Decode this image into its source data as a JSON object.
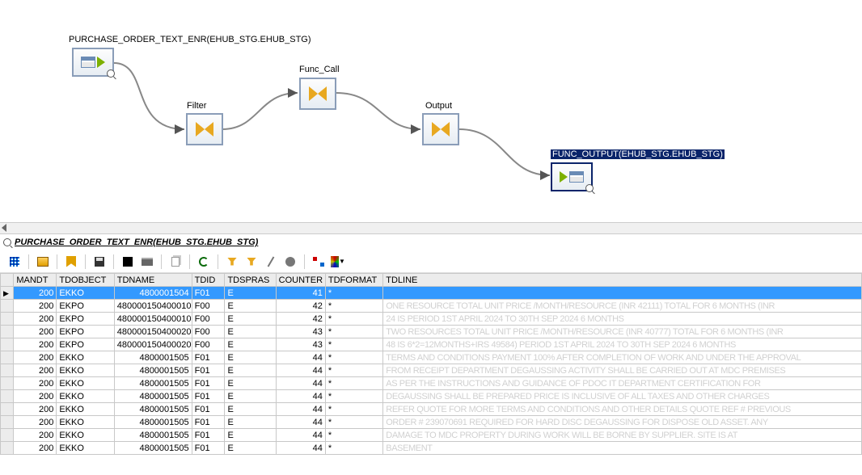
{
  "diagram": {
    "nodes": [
      {
        "id": 0,
        "label": "PURCHASE_ORDER_TEXT_ENR(EHUB_STG.EHUB_STG)",
        "type": "source"
      },
      {
        "id": 1,
        "label": "Filter",
        "type": "transform"
      },
      {
        "id": 2,
        "label": "Func_Call",
        "type": "transform"
      },
      {
        "id": 3,
        "label": "Output",
        "type": "transform"
      },
      {
        "id": 4,
        "label": "FUNC_OUTPUT(EHUB_STG.EHUB_STG)",
        "type": "target",
        "selected": true
      }
    ]
  },
  "tab_title": "PURCHASE_ORDER_TEXT_ENR(EHUB_STG.EHUB_STG)",
  "columns": [
    "MANDT",
    "TDOBJECT",
    "TDNAME",
    "TDID",
    "TDSPRAS",
    "COUNTER",
    "TDFORMAT",
    "TDLINE"
  ],
  "rows": [
    {
      "mandt": "200",
      "tdobject": "EKKO",
      "tdname": "4800001504",
      "tdid": "F01",
      "tdspras": "E",
      "counter": "41",
      "tdformat": "*",
      "tdline": "",
      "sel": true
    },
    {
      "mandt": "200",
      "tdobject": "EKPO",
      "tdname": "480000150400010",
      "tdid": "F00",
      "tdspras": "E",
      "counter": "42",
      "tdformat": "*",
      "tdline": "ONE RESOURCE TOTAL UNIT PRICE /MONTH/RESOURCE  (INR 42111) TOTAL FOR 6 MONTHS (INR"
    },
    {
      "mandt": "200",
      "tdobject": "EKPO",
      "tdname": "480000150400010",
      "tdid": "F00",
      "tdspras": "E",
      "counter": "42",
      "tdformat": "*",
      "tdline": "24 IS PERIOD  1ST APRIL 2024 TO 30TH SEP  2024 6 MONTHS"
    },
    {
      "mandt": "200",
      "tdobject": "EKPO",
      "tdname": "480000150400020",
      "tdid": "F00",
      "tdspras": "E",
      "counter": "43",
      "tdformat": "*",
      "tdline": "TWO RESOURCES TOTAL UNIT PRICE /MONTH/RESOURCE  (INR 40777) TOTAL FOR 6 MONTHS (INR"
    },
    {
      "mandt": "200",
      "tdobject": "EKPO",
      "tdname": "480000150400020",
      "tdid": "F00",
      "tdspras": "E",
      "counter": "43",
      "tdformat": "*",
      "tdline": "48 IS 6*2=12MONTHS+IRS  49584) PERIOD 1ST APRIL 2024 TO 30TH SEP 2024 6 MONTHS"
    },
    {
      "mandt": "200",
      "tdobject": "EKKO",
      "tdname": "4800001505",
      "tdid": "F01",
      "tdspras": "E",
      "counter": "44",
      "tdformat": "*",
      "tdline": "TERMS AND CONDITIONS  PAYMENT  100% AFTER COMPLETION OF WORK AND UNDER THE APPROVAL"
    },
    {
      "mandt": "200",
      "tdobject": "EKKO",
      "tdname": "4800001505",
      "tdid": "F01",
      "tdspras": "E",
      "counter": "44",
      "tdformat": "*",
      "tdline": "FROM RECEIPT DEPARTMENT  DEGAUSSING ACTIVITY SHALL BE CARRIED OUT AT  MDC PREMISES"
    },
    {
      "mandt": "200",
      "tdobject": "EKKO",
      "tdname": "4800001505",
      "tdid": "F01",
      "tdspras": "E",
      "counter": "44",
      "tdformat": "*",
      "tdline": "AS PER THE INSTRUCTIONS AND GUIDANCE OF PDOC IT DEPARTMENT  CERTIFICATION FOR"
    },
    {
      "mandt": "200",
      "tdobject": "EKKO",
      "tdname": "4800001505",
      "tdid": "F01",
      "tdspras": "E",
      "counter": "44",
      "tdformat": "*",
      "tdline": "DEGAUSSING SHALL BE PREPARED  PRICE IS INCLUSIVE OF ALL TAXES AND OTHER CHARGES"
    },
    {
      "mandt": "200",
      "tdobject": "EKKO",
      "tdname": "4800001505",
      "tdid": "F01",
      "tdspras": "E",
      "counter": "44",
      "tdformat": "*",
      "tdline": "REFER QUOTE FOR MORE TERMS AND CONDITIONS AND OTHER DETAILS QUOTE REF #   PREVIOUS"
    },
    {
      "mandt": "200",
      "tdobject": "EKKO",
      "tdname": "4800001505",
      "tdid": "F01",
      "tdspras": "E",
      "counter": "44",
      "tdformat": "*",
      "tdline": "ORDER # 239070691  REQUIRED FOR HARD DISC DEGAUSSING FOR DISPOSE OLD ASSET. ANY"
    },
    {
      "mandt": "200",
      "tdobject": "EKKO",
      "tdname": "4800001505",
      "tdid": "F01",
      "tdspras": "E",
      "counter": "44",
      "tdformat": "*",
      "tdline": "DAMAGE TO MDC PROPERTY DURING WORK WILL BE BORNE BY SUPPLIER. SITE IS AT"
    },
    {
      "mandt": "200",
      "tdobject": "EKKO",
      "tdname": "4800001505",
      "tdid": "F01",
      "tdspras": "E",
      "counter": "44",
      "tdformat": "*",
      "tdline": "BASEMENT"
    }
  ]
}
